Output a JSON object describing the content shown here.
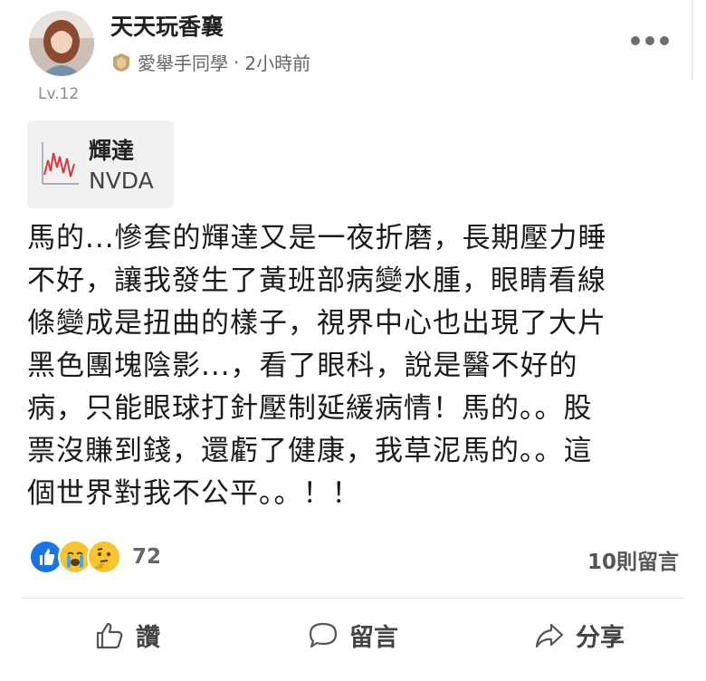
{
  "post": {
    "author": "天天玩香襄",
    "level": "Lv.12",
    "group": "愛舉手同學",
    "time_sep": "·",
    "time": "2小時前",
    "stock": {
      "name": "輝達",
      "code": "NVDA"
    },
    "content_lines": [
      "馬的...慘套的輝達又是一夜折磨，長期壓力睡",
      "不好，讓我發生了黃班部病變水腫，眼睛看線",
      "條變成是扭曲的樣子，視界中心也出現了大片",
      "黑色團塊陰影...，看了眼科，說是醫不好的",
      "病，只能眼球打針壓制延緩病情！馬的。。股",
      "票沒賺到錢，還虧了健康，我草泥馬的。。這",
      "個世界對我不公平。。！！"
    ],
    "reactions": {
      "icons": [
        "like-icon",
        "crying-face-icon",
        "thinking-face-icon"
      ],
      "count": "72"
    },
    "comments_count": "10則留言"
  },
  "actions": {
    "like": "讚",
    "comment": "留言",
    "share": "分享"
  },
  "colors": {
    "like_blue": "#1b74e4",
    "emoji_yellow": "#f7c531",
    "stock_line": "#d9363e"
  }
}
